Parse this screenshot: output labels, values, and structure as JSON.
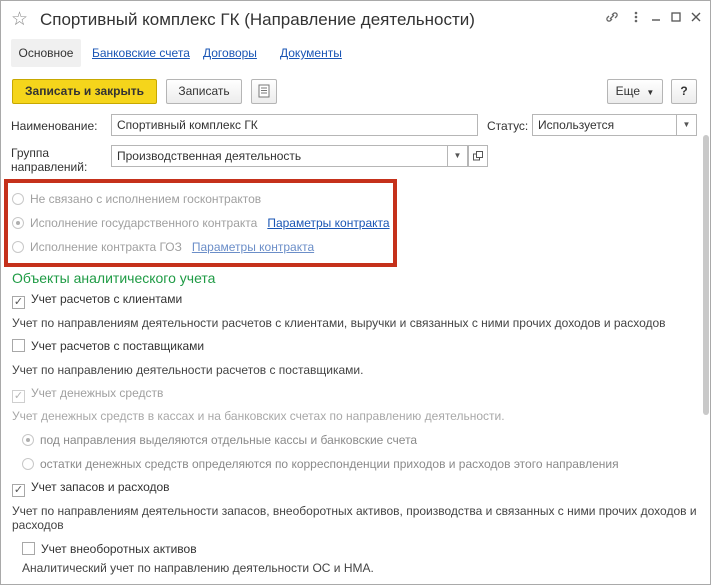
{
  "window": {
    "title": "Спортивный комплекс ГК (Направление деятельности)",
    "icons": [
      "star-icon",
      "link-icon",
      "more-icon",
      "minimize-icon",
      "maximize-icon",
      "close-icon"
    ]
  },
  "tabs": [
    {
      "label": "Основное",
      "active": true
    },
    {
      "label": "Банковские счета"
    },
    {
      "label": "Договоры"
    },
    {
      "label": "Документы"
    }
  ],
  "toolbar": {
    "save_close_label": "Записать и закрыть",
    "save_label": "Записать",
    "more_label": "Еще",
    "help_label": "?"
  },
  "form": {
    "name_label": "Наименование:",
    "name_value": "Спортивный комплекс ГК",
    "status_label": "Статус:",
    "status_value": "Используется",
    "group_label_line1": "Группа",
    "group_label_line2": "направлений:",
    "group_value": "Производственная деятельность"
  },
  "contract_options": {
    "opt1": "Не связано с исполнением госконтрактов",
    "opt2": "Исполнение государственного контракта",
    "opt2_link": "Параметры контракта",
    "opt3": "Исполнение контракта ГОЗ",
    "opt3_link": "Параметры контракта",
    "frame_color": "#c5311b"
  },
  "analytics": {
    "section_title": "Объекты аналитического учета",
    "clients_label": "Учет расчетов с клиентами",
    "clients_desc": "Учет по направлениям деятельности расчетов с клиентами, выручки и связанных с ними прочих доходов и расходов",
    "suppliers_label": "Учет расчетов с поставщиками",
    "suppliers_desc": "Учет по направлению деятельности расчетов с поставщиками.",
    "cash_label": "Учет денежных средств",
    "cash_desc": "Учет денежных средств в кассах и на банковских счетах по направлению деятельности.",
    "cash_opt1": "под направления выделяются отдельные кассы и банковские счета",
    "cash_opt2": "остатки денежных средств определяются по корреспонденции приходов и расходов этого направления",
    "stock_label": "Учет запасов и расходов",
    "stock_desc_line1": "Учет по направлениям деятельности запасов, внеоборотных активов, производства и связанных с ними прочих доходов и",
    "stock_desc_line2": "расходов",
    "fixed_label": "Учет внеоборотных активов",
    "fixed_desc": "Аналитический учет по направлению деятельности ОС и НМА."
  },
  "colors": {
    "primary_button": "#f5d51b",
    "link": "#1a56b5",
    "section_title": "#1f9b45"
  }
}
